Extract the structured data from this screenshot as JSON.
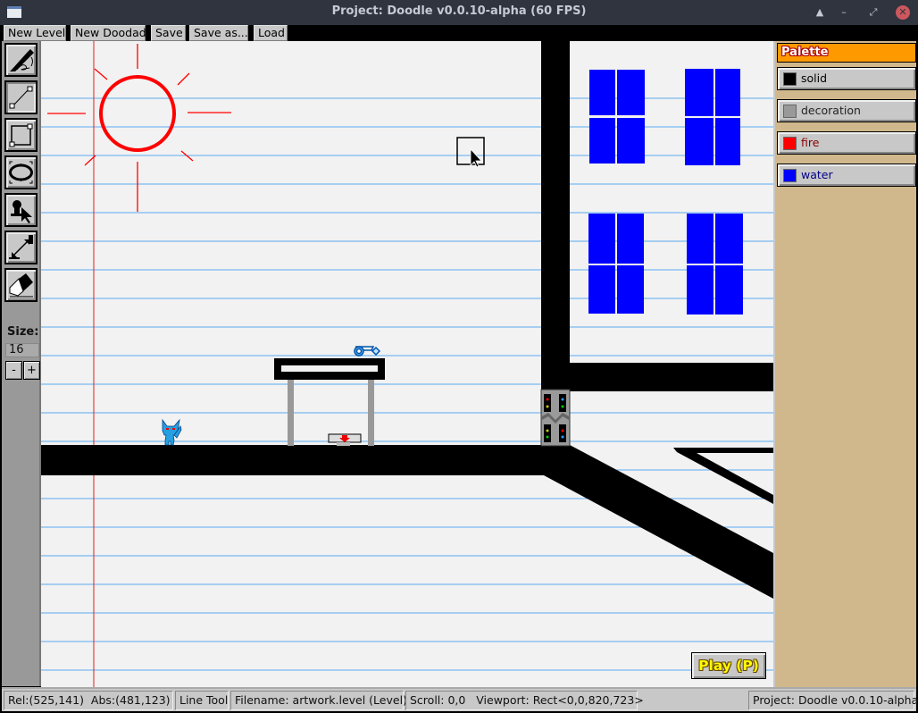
{
  "window": {
    "title": "Project: Doodle v0.0.10-alpha (60 FPS)",
    "controls": {
      "shade": "▲",
      "minimize": "–",
      "maximize": "⤢",
      "close": "✕"
    }
  },
  "menu": {
    "items": [
      {
        "label": "New Level"
      },
      {
        "label": "New Doodad"
      },
      {
        "label": "Save"
      },
      {
        "label": "Save as..."
      },
      {
        "label": "Load"
      }
    ]
  },
  "toolbar": {
    "tools": [
      {
        "name": "pencil-tool",
        "icon": "pencil-icon",
        "active": false
      },
      {
        "name": "line-tool",
        "icon": "line-icon",
        "active": true
      },
      {
        "name": "rect-tool",
        "icon": "rectangle-icon",
        "active": false
      },
      {
        "name": "ellipse-tool",
        "icon": "ellipse-icon",
        "active": false
      },
      {
        "name": "actor-tool",
        "icon": "actor-select-icon",
        "active": false
      },
      {
        "name": "link-tool",
        "icon": "link-icon",
        "active": false
      },
      {
        "name": "eraser-tool",
        "icon": "eraser-icon",
        "active": false
      }
    ],
    "size_label": "Size:",
    "size_value": "16",
    "minus_label": "-",
    "plus_label": "+"
  },
  "palette": {
    "title": "Palette",
    "swatches": [
      {
        "label": "solid",
        "color": "#000000",
        "text_color": "#000000"
      },
      {
        "label": "decoration",
        "color": "#999999",
        "text_color": "#222222"
      },
      {
        "label": "fire",
        "color": "#ff0000",
        "text_color": "#880000"
      },
      {
        "label": "water",
        "color": "#0000ff",
        "text_color": "#000088"
      }
    ]
  },
  "canvas": {
    "paper_line_color": "#5aa9f0",
    "margin_line_color": "#e02020",
    "doodads": [
      "blue-azulian-character",
      "blue-key",
      "trapdoor-button",
      "locked-door"
    ]
  },
  "play_button": {
    "label": "Play (P)"
  },
  "status": {
    "rel": "Rel:(525,141)",
    "abs": "Abs:(481,123)",
    "tool": "Line Tool",
    "filename": "Filename: artwork.level (Level)",
    "scroll": "Scroll: 0,0",
    "viewport": "Viewport: Rect<0,0,820,723>",
    "project": "Project: Doodle v0.0.10-alpha"
  }
}
